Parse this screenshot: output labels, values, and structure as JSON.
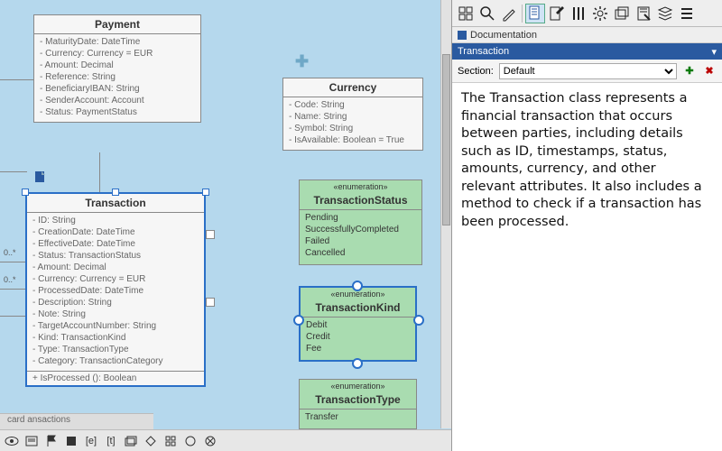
{
  "classes": {
    "payment": {
      "name": "Payment",
      "attrs": [
        "- MaturityDate: DateTime",
        "- Currency: Currency = EUR",
        "- Amount: Decimal",
        "- Reference: String",
        "- BeneficiaryIBAN: String",
        "- SenderAccount: Account",
        "- Status: PaymentStatus"
      ]
    },
    "currency": {
      "name": "Currency",
      "attrs": [
        "- Code: String",
        "- Name: String",
        "- Symbol: String",
        "- IsAvailable: Boolean = True"
      ]
    },
    "transaction": {
      "name": "Transaction",
      "attrs": [
        "- ID: String",
        "- CreationDate: DateTime",
        "- EffectiveDate: DateTime",
        "- Status: TransactionStatus",
        "- Amount: Decimal",
        "- Currency: Currency = EUR",
        "- ProcessedDate: DateTime",
        "- Description: String",
        "- Note: String",
        "- TargetAccountNumber: String",
        "- Kind: TransactionKind",
        "- Type: TransactionType",
        "- Category:  TransactionCategory"
      ],
      "methods": [
        "+ IsProcessed (): Boolean"
      ]
    },
    "transactionStatus": {
      "stereo": "«enumeration»",
      "name": "TransactionStatus",
      "values": [
        "Pending",
        "SuccessfullyCompleted",
        "Failed",
        "Cancelled"
      ]
    },
    "transactionKind": {
      "stereo": "«enumeration»",
      "name": "TransactionKind",
      "values": [
        "Debit",
        "Credit",
        "Fee"
      ]
    },
    "transactionType": {
      "stereo": "«enumeration»",
      "name": "TransactionType",
      "values": [
        "Transfer"
      ]
    }
  },
  "multiplicities": {
    "left": "0..*",
    "right": "0..*"
  },
  "tabs": {
    "partial": "card   ansactions"
  },
  "rightPanel": {
    "docLabel": "Documentation",
    "entity": "Transaction",
    "sectionLabel": "Section:",
    "sectionValue": "Default",
    "body": "The Transaction class represents a financial transaction that occurs between parties, including details such as ID, timestamps, status, amounts, currency, and other relevant attributes. It also includes a method to check if a transaction has been processed."
  },
  "icons": {
    "toolbar": [
      "grid",
      "picker",
      "pencil",
      "doc",
      "edit",
      "columns",
      "gear",
      "layers",
      "script",
      "stack",
      "list"
    ]
  }
}
